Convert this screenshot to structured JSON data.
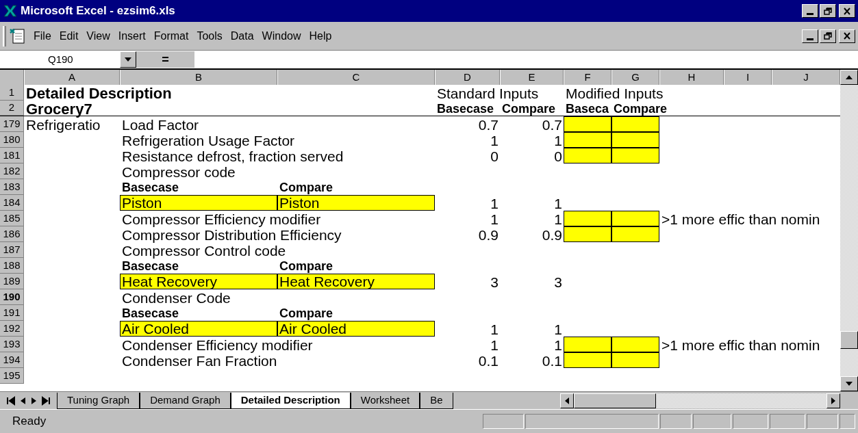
{
  "window": {
    "title": "Microsoft Excel - ezsim6.xls"
  },
  "menu": [
    "File",
    "Edit",
    "View",
    "Insert",
    "Format",
    "Tools",
    "Data",
    "Window",
    "Help"
  ],
  "formula_bar": {
    "name_box": "Q190",
    "equals": "="
  },
  "columns": [
    "A",
    "B",
    "C",
    "D",
    "E",
    "F",
    "G",
    "H",
    "I",
    "J"
  ],
  "rows": [
    {
      "num": "1",
      "selected": false,
      "cells": {
        "a": {
          "text": "Detailed Description",
          "kind": "title"
        },
        "d": {
          "text": "Standard Inputs"
        },
        "f": {
          "text": "Modified Inputs"
        }
      }
    },
    {
      "num": "2",
      "selected": false,
      "cells": {
        "a": {
          "text": "Grocery7",
          "kind": "title"
        },
        "d": {
          "text": "Basecase",
          "kind": "heading"
        },
        "e": {
          "text": "Compare",
          "kind": "heading"
        },
        "f": {
          "text": "Baseca",
          "kind": "heading"
        },
        "g": {
          "text": "Compare",
          "kind": "heading"
        }
      }
    },
    {
      "num": "179",
      "selected": false,
      "cells": {
        "a": {
          "text": "Refrigeratio"
        },
        "b": {
          "text": "Load Factor"
        },
        "d": {
          "text": "0.7"
        },
        "e": {
          "text": "0.7"
        },
        "f": {
          "highlighted": true
        },
        "g": {
          "highlighted": true
        }
      }
    },
    {
      "num": "180",
      "selected": false,
      "cells": {
        "b": {
          "text": "Refrigeration Usage Factor"
        },
        "d": {
          "text": "1"
        },
        "e": {
          "text": "1"
        },
        "f": {
          "highlighted": true
        },
        "g": {
          "highlighted": true
        }
      }
    },
    {
      "num": "181",
      "selected": false,
      "cells": {
        "b": {
          "text": "Resistance defrost, fraction served"
        },
        "d": {
          "text": "0"
        },
        "e": {
          "text": "0"
        },
        "f": {
          "highlighted": true
        },
        "g": {
          "highlighted": true
        }
      }
    },
    {
      "num": "182",
      "selected": false,
      "cells": {
        "b": {
          "text": "Compressor code"
        }
      }
    },
    {
      "num": "183",
      "selected": false,
      "cells": {
        "b": {
          "text": "Basecase",
          "kind": "heading"
        },
        "c": {
          "text": "Compare",
          "kind": "heading"
        }
      }
    },
    {
      "num": "184",
      "selected": false,
      "cells": {
        "b": {
          "text": "Piston",
          "highlighted": true
        },
        "c": {
          "text": "Piston",
          "highlighted": true
        },
        "d": {
          "text": "1"
        },
        "e": {
          "text": "1"
        }
      }
    },
    {
      "num": "185",
      "selected": false,
      "cells": {
        "b": {
          "text": "Compressor Efficiency modifier"
        },
        "d": {
          "text": "1"
        },
        "e": {
          "text": "1"
        },
        "f": {
          "highlighted": true
        },
        "g": {
          "highlighted": true
        },
        "h": {
          "text": ">1 more effic than nomin"
        }
      }
    },
    {
      "num": "186",
      "selected": false,
      "cells": {
        "b": {
          "text": "Compressor Distribution Efficiency"
        },
        "d": {
          "text": "0.9"
        },
        "e": {
          "text": "0.9"
        },
        "f": {
          "highlighted": true
        },
        "g": {
          "highlighted": true
        }
      }
    },
    {
      "num": "187",
      "selected": false,
      "cells": {
        "b": {
          "text": "Compressor Control code"
        }
      }
    },
    {
      "num": "188",
      "selected": false,
      "cells": {
        "b": {
          "text": "Basecase",
          "kind": "heading"
        },
        "c": {
          "text": "Compare",
          "kind": "heading"
        }
      }
    },
    {
      "num": "189",
      "selected": false,
      "cells": {
        "b": {
          "text": "Heat Recovery",
          "highlighted": true
        },
        "c": {
          "text": "Heat Recovery",
          "highlighted": true
        },
        "d": {
          "text": "3"
        },
        "e": {
          "text": "3"
        }
      }
    },
    {
      "num": "190",
      "selected": true,
      "cells": {
        "b": {
          "text": "Condenser Code"
        }
      }
    },
    {
      "num": "191",
      "selected": false,
      "cells": {
        "b": {
          "text": "Basecase",
          "kind": "heading"
        },
        "c": {
          "text": "Compare",
          "kind": "heading"
        }
      }
    },
    {
      "num": "192",
      "selected": false,
      "cells": {
        "b": {
          "text": "Air Cooled",
          "highlighted": true
        },
        "c": {
          "text": "Air Cooled",
          "highlighted": true
        },
        "d": {
          "text": "1"
        },
        "e": {
          "text": "1"
        }
      }
    },
    {
      "num": "193",
      "selected": false,
      "cells": {
        "b": {
          "text": "Condenser Efficiency modifier"
        },
        "d": {
          "text": "1"
        },
        "e": {
          "text": "1"
        },
        "f": {
          "highlighted": true
        },
        "g": {
          "highlighted": true
        },
        "h": {
          "text": ">1 more effic than nomin"
        }
      }
    },
    {
      "num": "194",
      "selected": false,
      "cells": {
        "b": {
          "text": "Condenser Fan Fraction"
        },
        "d": {
          "text": "0.1"
        },
        "e": {
          "text": "0.1"
        },
        "f": {
          "highlighted": true
        },
        "g": {
          "highlighted": true
        }
      }
    },
    {
      "num": "195",
      "selected": false,
      "cells": {}
    }
  ],
  "sheet_tabs": [
    {
      "label": "Tuning Graph",
      "selected": false
    },
    {
      "label": "Demand Graph",
      "selected": false
    },
    {
      "label": "Detailed Description",
      "selected": true
    },
    {
      "label": "Worksheet",
      "selected": false
    },
    {
      "label": "Be",
      "selected": false
    }
  ],
  "status_bar": {
    "text": "Ready"
  }
}
